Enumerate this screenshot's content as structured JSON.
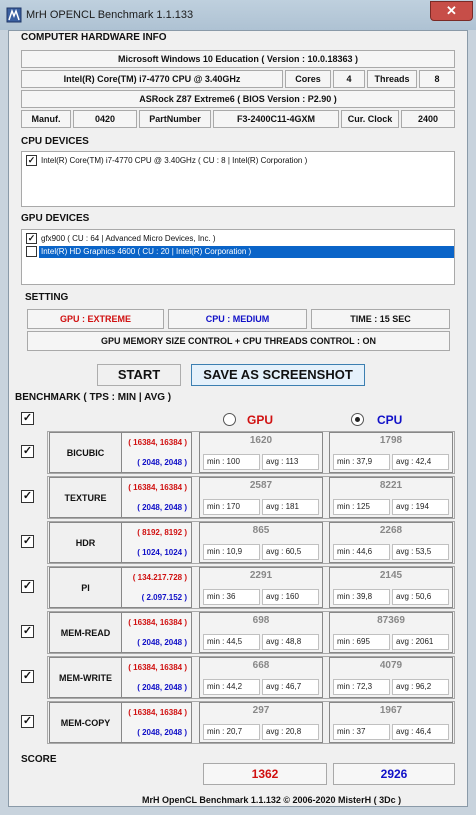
{
  "window": {
    "title": "MrH OPENCL Benchmark 1.1.133",
    "close_glyph": "✕"
  },
  "hardware": {
    "section_title": "COMPUTER HARDWARE INFO",
    "os": "Microsoft Windows 10 Education ( Version : 10.0.18363 )",
    "cpu_name": "Intel(R) Core(TM) i7-4770 CPU @ 3.40GHz",
    "cores_label": "Cores",
    "cores_value": "4",
    "threads_label": "Threads",
    "threads_value": "8",
    "board": "ASRock Z87 Extreme6 ( BIOS Version : P2.90 )",
    "manuf_label": "Manuf.",
    "manuf_value": "0420",
    "partnumber_label": "PartNumber",
    "partnumber_value": "F3-2400C11-4GXM",
    "clock_label": "Cur. Clock",
    "clock_value": "2400"
  },
  "cpu_devices": {
    "title": "CPU DEVICES",
    "items": [
      {
        "label": "Intel(R) Core(TM) i7-4770 CPU @ 3.40GHz ( CU : 8 | Intel(R) Corporation )",
        "checked": "✓"
      }
    ]
  },
  "gpu_devices": {
    "title": "GPU DEVICES",
    "items": [
      {
        "label": "gfx900 ( CU : 64 | Advanced Micro Devices, Inc. )",
        "checked": "✓"
      },
      {
        "label": "Intel(R) HD Graphics 4600 ( CU : 20 | Intel(R) Corporation )",
        "checked": ""
      }
    ]
  },
  "setting": {
    "title": "SETTING",
    "gpu": "GPU : EXTREME",
    "cpu": "CPU : MEDIUM",
    "time": "TIME : 15 SEC",
    "control": "GPU MEMORY SIZE CONTROL + CPU THREADS CONTROL : ON"
  },
  "buttons": {
    "start": "START",
    "screenshot": "SAVE AS SCREENSHOT"
  },
  "benchmark": {
    "title": "BENCHMARK ( TPS : MIN | AVG )",
    "all_checked": "✓",
    "gpu_label": "GPU",
    "cpu_label": "CPU",
    "rows": [
      {
        "name": "BICUBIC",
        "checked": "✓",
        "gpu_param": "( 16384, 16384 )",
        "cpu_param": "( 2048, 2048 )",
        "gpu_score": "1620",
        "gpu_min": "min : 100",
        "gpu_avg": "avg : 113",
        "cpu_score": "1798",
        "cpu_min": "min : 37,9",
        "cpu_avg": "avg : 42,4"
      },
      {
        "name": "TEXTURE",
        "checked": "✓",
        "gpu_param": "( 16384, 16384 )",
        "cpu_param": "( 2048, 2048 )",
        "gpu_score": "2587",
        "gpu_min": "min : 170",
        "gpu_avg": "avg : 181",
        "cpu_score": "8221",
        "cpu_min": "min : 125",
        "cpu_avg": "avg : 194"
      },
      {
        "name": "HDR",
        "checked": "✓",
        "gpu_param": "( 8192, 8192 )",
        "cpu_param": "( 1024, 1024 )",
        "gpu_score": "865",
        "gpu_min": "min : 10,9",
        "gpu_avg": "avg : 60,5",
        "cpu_score": "2268",
        "cpu_min": "min : 44,6",
        "cpu_avg": "avg : 53,5"
      },
      {
        "name": "PI",
        "checked": "✓",
        "gpu_param": "( 134.217.728 )",
        "cpu_param": "( 2.097.152 )",
        "gpu_score": "2291",
        "gpu_min": "min : 36",
        "gpu_avg": "avg : 160",
        "cpu_score": "2145",
        "cpu_min": "min : 39,8",
        "cpu_avg": "avg : 50,6"
      },
      {
        "name": "MEM-READ",
        "checked": "✓",
        "gpu_param": "( 16384, 16384 )",
        "cpu_param": "( 2048, 2048 )",
        "gpu_score": "698",
        "gpu_min": "min : 44,5",
        "gpu_avg": "avg : 48,8",
        "cpu_score": "87369",
        "cpu_min": "min : 695",
        "cpu_avg": "avg : 2061"
      },
      {
        "name": "MEM-WRITE",
        "checked": "✓",
        "gpu_param": "( 16384, 16384 )",
        "cpu_param": "( 2048, 2048 )",
        "gpu_score": "668",
        "gpu_min": "min : 44,2",
        "gpu_avg": "avg : 46,7",
        "cpu_score": "4079",
        "cpu_min": "min : 72,3",
        "cpu_avg": "avg : 96,2"
      },
      {
        "name": "MEM-COPY",
        "checked": "✓",
        "gpu_param": "( 16384, 16384 )",
        "cpu_param": "( 2048, 2048 )",
        "gpu_score": "297",
        "gpu_min": "min : 20,7",
        "gpu_avg": "avg : 20,8",
        "cpu_score": "1967",
        "cpu_min": "min : 37",
        "cpu_avg": "avg : 46,4"
      }
    ]
  },
  "score": {
    "title": "SCORE",
    "gpu": "1362",
    "cpu": "2926"
  },
  "footer": "MrH OpenCL Benchmark 1.1.132  ©  2006-2020 MisterH ( 3Dc )",
  "colors": {
    "gpu_red": "#d01010",
    "cpu_blue": "#1010c8",
    "selection": "#0a64c8"
  }
}
